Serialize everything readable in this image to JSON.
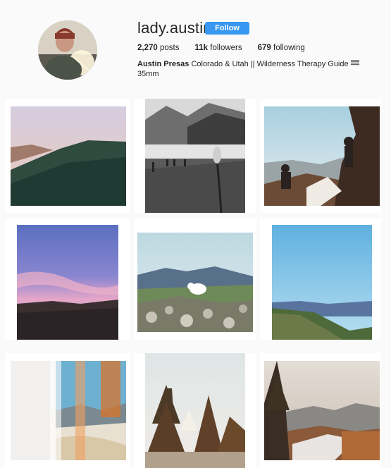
{
  "profile": {
    "username": "lady.austin",
    "follow_label": "Follow",
    "stats": {
      "posts_count": "2,270",
      "posts_label": "posts",
      "followers_count": "11k",
      "followers_label": "followers",
      "following_count": "679",
      "following_label": "following"
    },
    "bio": {
      "name": "Austin Presas",
      "text_line1": "Colorado & Utah || Wilderness Therapy Guide",
      "text_line2": "35mm"
    }
  },
  "posts": [
    {
      "subject": "forested ridge at dusk"
    },
    {
      "subject": "black and white hikers in meadow"
    },
    {
      "subject": "hikers climbing rock"
    },
    {
      "subject": "pink and purple sunset sky"
    },
    {
      "subject": "mountain goat on rocky ridge"
    },
    {
      "subject": "blue sky over distant ranges"
    },
    {
      "subject": "light leak mountain valley"
    },
    {
      "subject": "pine trees and tent at camp"
    },
    {
      "subject": "pine tree and river valley"
    }
  ],
  "colors": {
    "follow_button": "#3897f0",
    "background": "#fafafa"
  }
}
